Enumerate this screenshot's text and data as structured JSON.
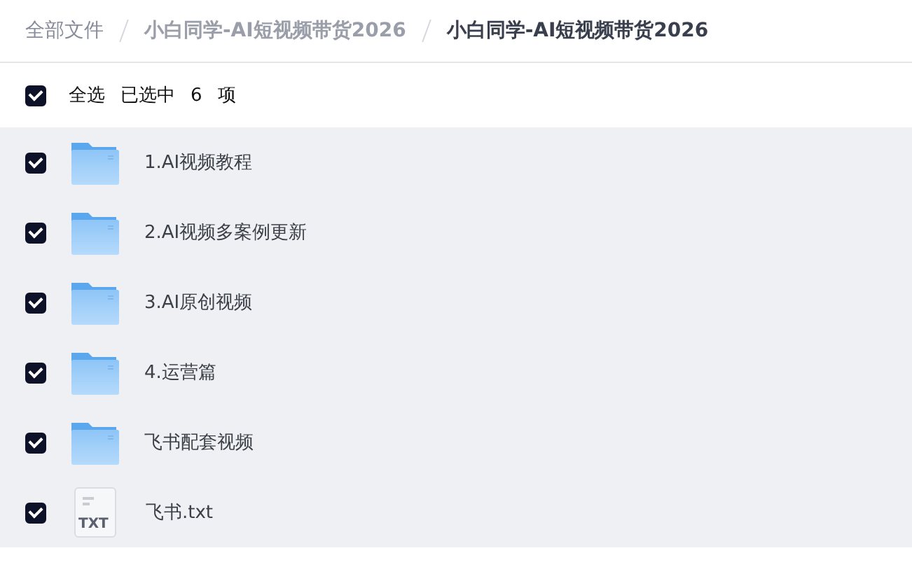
{
  "breadcrumb": [
    {
      "label": "全部文件",
      "current": false
    },
    {
      "label": "小白同学-AI短视频带货2026",
      "current": false
    },
    {
      "label": "小白同学-AI短视频带货2026",
      "current": true
    }
  ],
  "select_all": {
    "checked": true,
    "label": "全选",
    "summary": "已选中",
    "count": "6",
    "unit": "项"
  },
  "files": [
    {
      "kind": "folder",
      "name": "1.AI视频教程",
      "selected": true
    },
    {
      "kind": "folder",
      "name": "2.AI视频多案例更新",
      "selected": true
    },
    {
      "kind": "folder",
      "name": "3.AI原创视频",
      "selected": true
    },
    {
      "kind": "folder",
      "name": "4.运营篇",
      "selected": true
    },
    {
      "kind": "folder",
      "name": "飞书配套视频",
      "selected": true
    },
    {
      "kind": "file",
      "name": "飞书.txt",
      "badge": "TXT",
      "selected": true
    }
  ]
}
